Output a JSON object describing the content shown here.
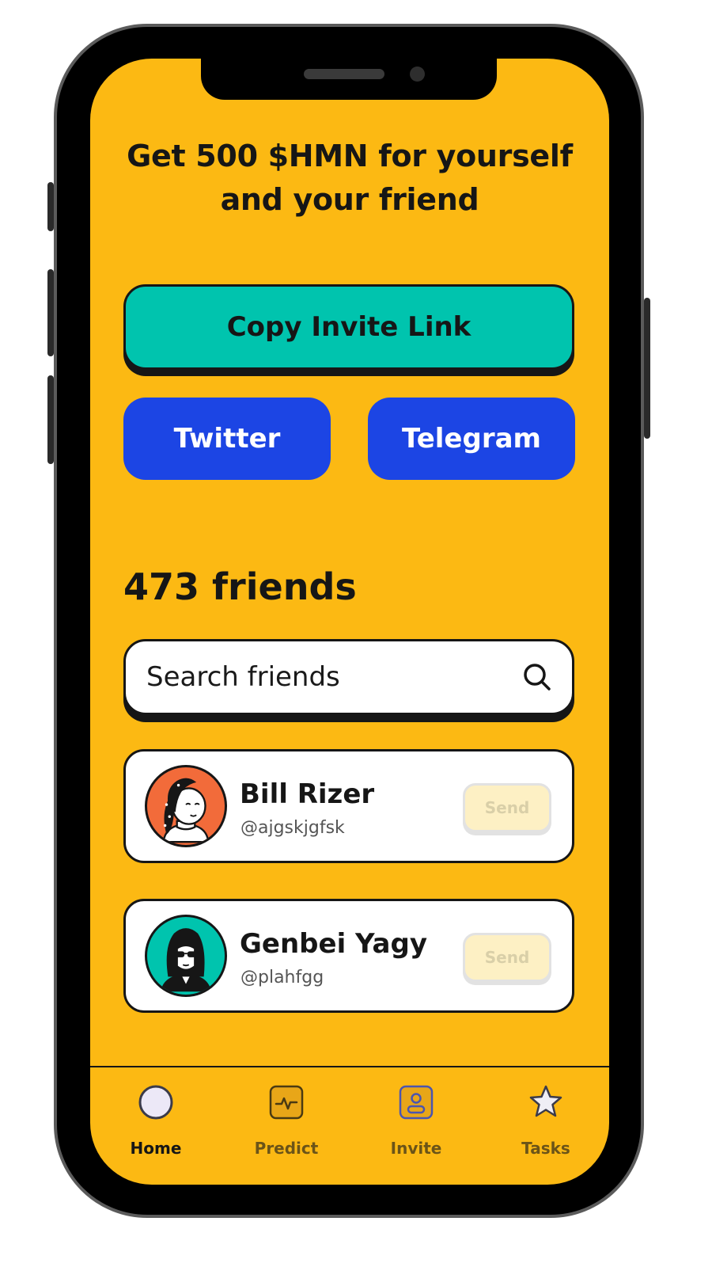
{
  "headline": "Get 500 $HMN for yourself and your friend",
  "buttons": {
    "copy_invite": "Copy Invite Link",
    "twitter": "Twitter",
    "telegram": "Telegram"
  },
  "friends_count": "473 friends",
  "search": {
    "placeholder": "Search friends"
  },
  "friends": [
    {
      "name": "Bill Rizer",
      "handle": "@ajgskjgfsk",
      "send_label": "Send",
      "avatar_color": "#f26b3a"
    },
    {
      "name": "Genbei Yagy",
      "handle": "@plahfgg",
      "send_label": "Send",
      "avatar_color": "#00c4ae"
    }
  ],
  "nav": [
    {
      "label": "Home",
      "icon": "home-icon",
      "active": true
    },
    {
      "label": "Predict",
      "icon": "predict-icon",
      "active": false
    },
    {
      "label": "Invite",
      "icon": "invite-icon",
      "active": false
    },
    {
      "label": "Tasks",
      "icon": "tasks-icon",
      "active": false
    }
  ],
  "colors": {
    "background": "#fcb913",
    "teal": "#00c4ae",
    "blue": "#1c45e4",
    "dark": "#161616"
  }
}
